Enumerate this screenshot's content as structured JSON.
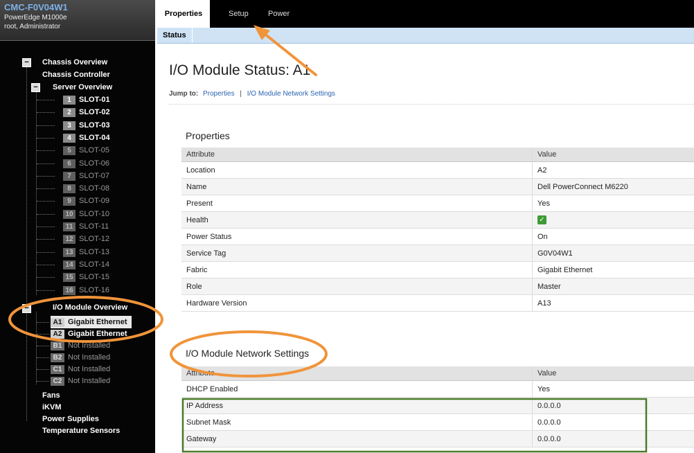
{
  "header": {
    "title": "CMC-F0V04W1",
    "model": "PowerEdge M1000e",
    "user": "root, Administrator"
  },
  "tree": {
    "chassis_overview": "Chassis Overview",
    "chassis_controller": "Chassis Controller",
    "server_overview": "Server Overview",
    "slots": [
      {
        "num": "1",
        "label": "SLOT-01",
        "dim": false
      },
      {
        "num": "2",
        "label": "SLOT-02",
        "dim": false
      },
      {
        "num": "3",
        "label": "SLOT-03",
        "dim": false
      },
      {
        "num": "4",
        "label": "SLOT-04",
        "dim": false
      },
      {
        "num": "5",
        "label": "SLOT-05",
        "dim": true
      },
      {
        "num": "6",
        "label": "SLOT-06",
        "dim": true
      },
      {
        "num": "7",
        "label": "SLOT-07",
        "dim": true
      },
      {
        "num": "8",
        "label": "SLOT-08",
        "dim": true
      },
      {
        "num": "9",
        "label": "SLOT-09",
        "dim": true
      },
      {
        "num": "10",
        "label": "SLOT-10",
        "dim": true
      },
      {
        "num": "11",
        "label": "SLOT-11",
        "dim": true
      },
      {
        "num": "12",
        "label": "SLOT-12",
        "dim": true
      },
      {
        "num": "13",
        "label": "SLOT-13",
        "dim": true
      },
      {
        "num": "14",
        "label": "SLOT-14",
        "dim": true
      },
      {
        "num": "15",
        "label": "SLOT-15",
        "dim": true
      },
      {
        "num": "16",
        "label": "SLOT-16",
        "dim": true
      }
    ],
    "io_overview": "I/O Module Overview",
    "io_modules": [
      {
        "num": "A1",
        "label": "Gigabit Ethernet",
        "dim": false,
        "selected": true
      },
      {
        "num": "A2",
        "label": "Gigabit Ethernet",
        "dim": false,
        "selected": false
      },
      {
        "num": "B1",
        "label": "Not Installed",
        "dim": true,
        "selected": false
      },
      {
        "num": "B2",
        "label": "Not Installed",
        "dim": true,
        "selected": false
      },
      {
        "num": "C1",
        "label": "Not Installed",
        "dim": true,
        "selected": false
      },
      {
        "num": "C2",
        "label": "Not Installed",
        "dim": true,
        "selected": false
      }
    ],
    "fans": "Fans",
    "ikvm": "iKVM",
    "power_supplies": "Power Supplies",
    "temperature_sensors": "Temperature Sensors"
  },
  "tabs": [
    "Properties",
    "Setup",
    "Power"
  ],
  "subtab": "Status",
  "page_title": "I/O Module Status: A1",
  "jump": {
    "label": "Jump to:",
    "link1": "Properties",
    "sep": "|",
    "link2": "I/O Module Network Settings"
  },
  "properties": {
    "title": "Properties",
    "col_attr": "Attribute",
    "col_value": "Value",
    "rows": [
      {
        "attr": "Location",
        "value": "A2"
      },
      {
        "attr": "Name",
        "value": "Dell PowerConnect M6220"
      },
      {
        "attr": "Present",
        "value": "Yes"
      },
      {
        "attr": "Health",
        "value": "✓"
      },
      {
        "attr": "Power Status",
        "value": "On"
      },
      {
        "attr": "Service Tag",
        "value": "G0V04W1"
      },
      {
        "attr": "Fabric",
        "value": "Gigabit Ethernet"
      },
      {
        "attr": "Role",
        "value": "Master"
      },
      {
        "attr": "Hardware Version",
        "value": "A13"
      }
    ]
  },
  "network": {
    "title": "I/O Module Network Settings",
    "col_attr": "Attribute",
    "col_value": "Value",
    "rows": [
      {
        "attr": "DHCP Enabled",
        "value": "Yes"
      },
      {
        "attr": "IP Address",
        "value": "0.0.0.0"
      },
      {
        "attr": "Subnet Mask",
        "value": "0.0.0.0"
      },
      {
        "attr": "Gateway",
        "value": "0.0.0.0"
      }
    ]
  },
  "colors": {
    "annotation_orange": "#f0943a",
    "annotation_green": "#4b7a2a",
    "link": "#2a62b0"
  }
}
